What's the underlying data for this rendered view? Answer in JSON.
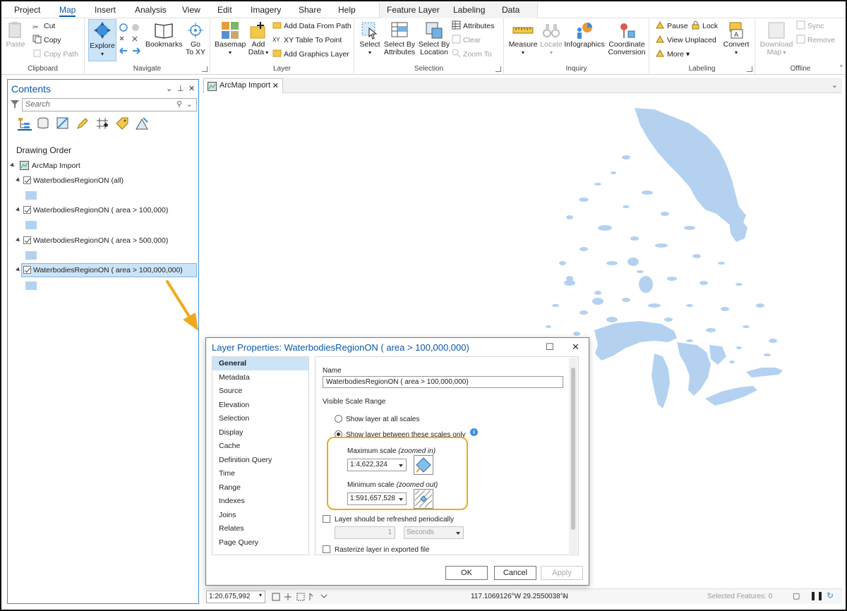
{
  "menu": {
    "tabs": [
      "Project",
      "Map",
      "Insert",
      "Analysis",
      "View",
      "Edit",
      "Imagery",
      "Share",
      "Help"
    ],
    "active": "Map",
    "context_tabs": [
      "Feature Layer",
      "Labeling",
      "Data"
    ]
  },
  "ribbon": {
    "clipboard": {
      "label": "Clipboard",
      "paste": "Paste",
      "cut": "Cut",
      "copy": "Copy",
      "copy_path": "Copy Path"
    },
    "navigate": {
      "label": "Navigate",
      "explore": "Explore",
      "bookmarks": "Bookmarks",
      "go_to_xy_1": "Go",
      "go_to_xy_2": "To XY"
    },
    "layer": {
      "label": "Layer",
      "basemap": "Basemap",
      "add_data_1": "Add",
      "add_data_2": "Data",
      "add_from_path": "Add Data From Path",
      "xy_table": "XY Table To Point",
      "add_graphics": "Add Graphics Layer"
    },
    "selection": {
      "label": "Selection",
      "select": "Select",
      "select_by_attr_1": "Select By",
      "select_by_attr_2": "Attributes",
      "select_by_loc_1": "Select By",
      "select_by_loc_2": "Location",
      "attributes": "Attributes",
      "clear": "Clear",
      "zoom_to": "Zoom To"
    },
    "inquiry": {
      "label": "Inquiry",
      "measure": "Measure",
      "locate": "Locate",
      "infographics": "Infographics",
      "coord_conv_1": "Coordinate",
      "coord_conv_2": "Conversion"
    },
    "labeling": {
      "label": "Labeling",
      "pause": "Pause",
      "lock": "Lock",
      "view_unplaced": "View Unplaced",
      "more": "More",
      "convert": "Convert"
    },
    "offline": {
      "label": "Offline",
      "download_1": "Download",
      "download_2": "Map",
      "sync": "Sync",
      "remove": "Remove"
    }
  },
  "contents": {
    "title": "Contents",
    "search_placeholder": "Search",
    "drawing_order": "Drawing Order",
    "map_name": "ArcMap Import",
    "layers": [
      "WaterbodiesRegionON (all)",
      "WaterbodiesRegionON ( area > 100,000)",
      "WaterbodiesRegionON ( area > 500,000)",
      "WaterbodiesRegionON ( area > 100,000,000)"
    ]
  },
  "map": {
    "tab_title": "ArcMap Import",
    "scale": "1:20,675,992",
    "coordinates": "117.1069126°W 29.2550038°N",
    "selected_features": "Selected Features: 0"
  },
  "dialog": {
    "title": "Layer Properties: WaterbodiesRegionON ( area > 100,000,000)",
    "nav": [
      "General",
      "Metadata",
      "Source",
      "Elevation",
      "Selection",
      "Display",
      "Cache",
      "Definition Query",
      "Time",
      "Range",
      "Indexes",
      "Joins",
      "Relates",
      "Page Query"
    ],
    "active_nav": "General",
    "name_label": "Name",
    "name_value": "WaterbodiesRegionON ( area > 100,000,000)",
    "visible_scale_range": "Visible Scale Range",
    "show_all": "Show layer at all scales",
    "show_between": "Show layer between these scales only",
    "max_scale_label": "Maximum scale",
    "max_scale_hint": "(zoomed in)",
    "max_scale_value": "1:4,622,324",
    "min_scale_label": "Minimum scale",
    "min_scale_hint": "(zoomed out)",
    "min_scale_value": "1:591,657,528",
    "refresh_label": "Layer should be refreshed periodically",
    "refresh_value": "1",
    "refresh_units": "Seconds",
    "rasterize_label": "Rasterize layer in exported file",
    "ok": "OK",
    "cancel": "Cancel",
    "apply": "Apply"
  },
  "colors": {
    "accent": "#0a58a8",
    "water": "#b4d2f0",
    "highlight": "#f0a91e",
    "selected_bg": "#cce4f7"
  }
}
